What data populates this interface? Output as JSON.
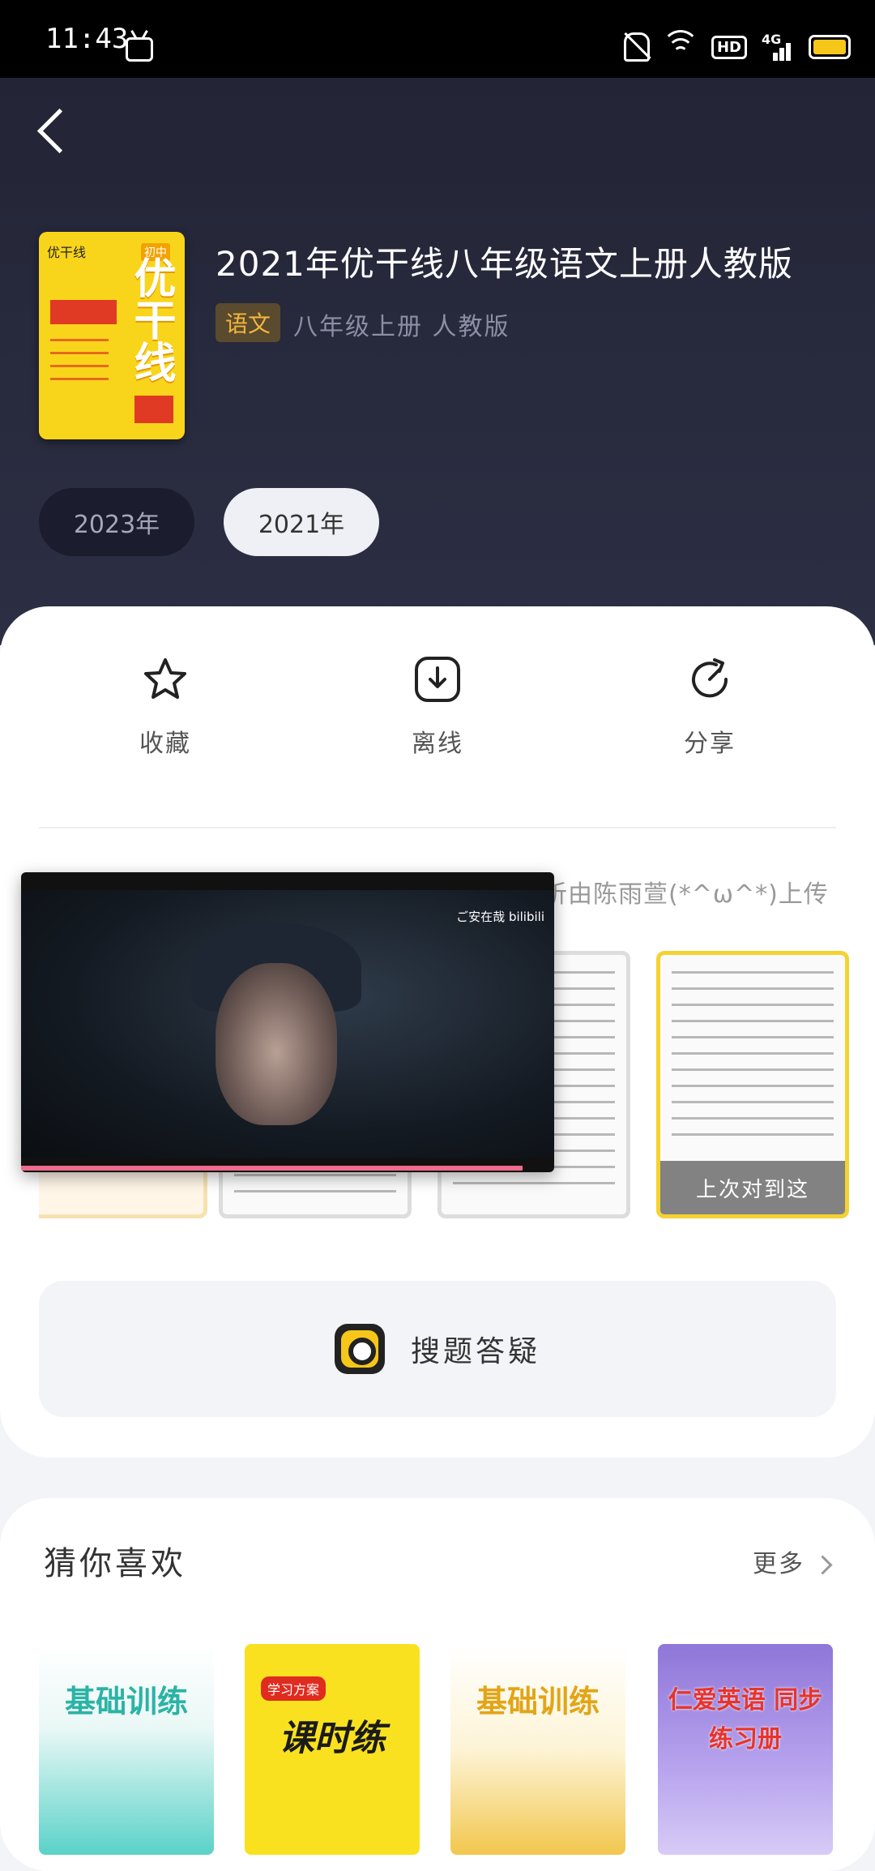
{
  "status_bar": {
    "time": "11:43",
    "network": "4G",
    "hd": "HD"
  },
  "book": {
    "title": "2021年优干线八年级语文上册人教版",
    "subject_tag": "语文",
    "meta": "八年级上册  人教版",
    "cover": {
      "series": "优干线",
      "big_title": "优干线",
      "badge": "初中"
    }
  },
  "years": [
    "2023年",
    "2021年"
  ],
  "actions": [
    {
      "label": "收藏",
      "icon": "star-icon"
    },
    {
      "label": "离线",
      "icon": "download-icon"
    },
    {
      "label": "分享",
      "icon": "share-icon"
    }
  ],
  "uploader_text": "析由陈雨萱(*^ω^*)上传",
  "last_stop_label": "上次对到这",
  "search_button": "搜题答疑",
  "recommend": {
    "title": "猜你喜欢",
    "more": "更多"
  },
  "recommend_books": [
    {
      "title": "基础训练"
    },
    {
      "title": "课时练"
    },
    {
      "title": "基础训练"
    },
    {
      "title": "仁爱英语 同步练习册"
    }
  ],
  "video": {
    "watermark": "ご安在哉 bilibili",
    "progress": 0.94
  },
  "colors": {
    "accent": "#f6c619",
    "hero_bg": "#2a2c40",
    "tag_text": "#f2b63a",
    "video_progress": "#f16b8d"
  }
}
